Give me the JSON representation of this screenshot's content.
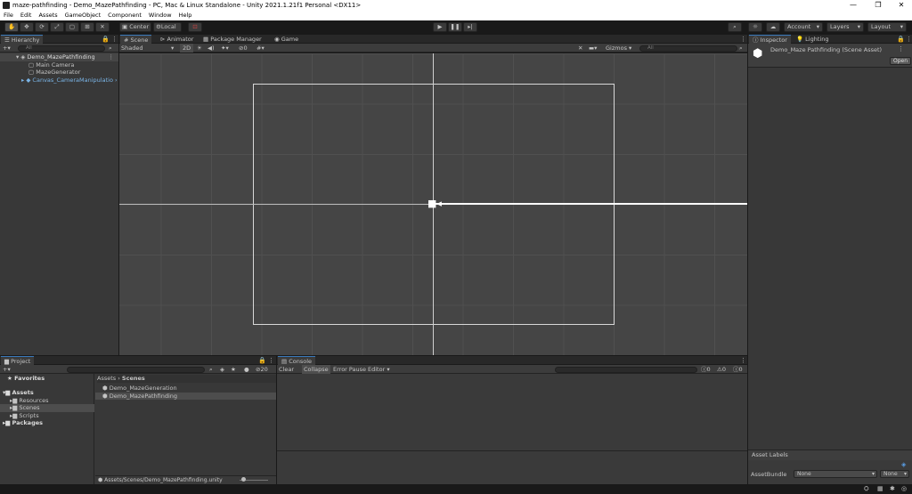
{
  "window": {
    "title": "maze-pathfinding - Demo_MazePathfinding - PC, Mac & Linux Standalone - Unity 2021.1.21f1 Personal <DX11>",
    "controls": {
      "minimize": "—",
      "restore": "❐",
      "close": "✕"
    }
  },
  "menu": [
    "File",
    "Edit",
    "Assets",
    "GameObject",
    "Component",
    "Window",
    "Help"
  ],
  "toolbar": {
    "pivot": "Center",
    "space": "Local",
    "account": "Account",
    "layers": "Layers",
    "layout": "Layout"
  },
  "hierarchy": {
    "tab": "Hierarchy",
    "search_placeholder": "All",
    "scene": "Demo_MazePathfinding",
    "items": [
      "Main Camera",
      "MazeGenerator",
      "Canvas_CameraManipulatio"
    ]
  },
  "scene_view": {
    "tabs": [
      "Scene",
      "Animator",
      "Package Manager",
      "Game"
    ],
    "shading": "Shaded",
    "mode_2d": "2D",
    "hidden_count": "0",
    "gizmos": "Gizmos",
    "search_placeholder": "All"
  },
  "inspector": {
    "tabs": [
      "Inspector",
      "Lighting"
    ],
    "asset_title": "Demo_Maze Pathfinding (Scene Asset)",
    "open_button": "Open",
    "asset_labels": "Asset Labels",
    "asset_bundle_label": "AssetBundle",
    "asset_bundle_value": "None",
    "asset_variant_value": "None"
  },
  "project": {
    "tab": "Project",
    "favorites": "Favorites",
    "assets": "Assets",
    "folders": [
      "Resources",
      "Scenes",
      "Scripts"
    ],
    "packages": "Packages",
    "breadcrumb": [
      "Assets",
      "Scenes"
    ],
    "files": [
      "Demo_MazeGeneration",
      "Demo_MazePathfinding"
    ],
    "footer_path": "Assets/Scenes/Demo_MazePathfinding.unity",
    "hidden_count": "20"
  },
  "console": {
    "tab": "Console",
    "buttons": [
      "Clear",
      "Collapse",
      "Error Pause",
      "Editor"
    ],
    "counts": {
      "log": "0",
      "warn": "0",
      "error": "0"
    }
  },
  "colors": {
    "accent": "#3a79bb",
    "selection": "#2c5d87"
  }
}
